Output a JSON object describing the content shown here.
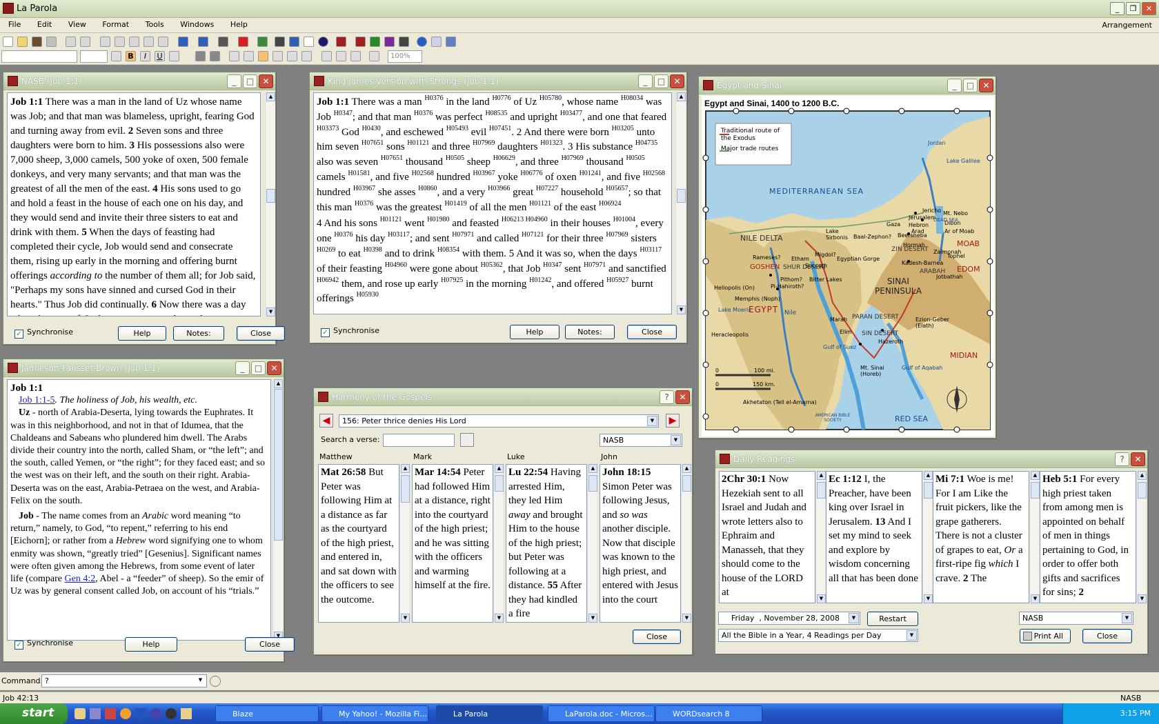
{
  "app": {
    "title": "La Parola"
  },
  "menu": [
    "File",
    "Edit",
    "View",
    "Format",
    "Tools",
    "Windows",
    "Help"
  ],
  "menu_right": "Arrangement",
  "format_bar": {
    "zoom": "100%"
  },
  "nasb": {
    "title": "NASB (Job 1:1)",
    "synchronise": "Synchronise",
    "help": "Help",
    "notes": "Notes:",
    "close": "Close",
    "ref": "Job 1:1",
    "text_a": " There was a man in the land of Uz whose name was Job; and that man was blameless, upright, fearing God and turning away from evil. ",
    "v2": "2",
    "text_b": " Seven sons and three daughters were born to him. ",
    "v3": "3",
    "text_c": " His possessions also were 7,000 sheep, 3,000 camels, 500 yoke of oxen, 500 female donkeys, and very many servants; and that man was the greatest of all the men of the east. ",
    "v4": "4",
    "text_d": " His sons used to go and hold a feast in the house of each one on his day, and they would send and invite their three sisters to eat and drink with them. ",
    "v5": "5",
    "text_e": " When the days of feasting had completed their cycle, Job would send and consecrate them, rising up early in the morning and offering burnt offerings ",
    "text_e_it": "according to",
    "text_f": " the number of them all; for Job said, \"Perhaps my sons have sinned and cursed God in their hearts.\" Thus Job did continually. ",
    "v6": "6",
    "text_g": " Now there was a day when the sons of God came to present themselves"
  },
  "kjv": {
    "title": "King James Version with Strongs (Job 1:1)",
    "synchronise": "Synchronise",
    "help": "Help",
    "notes": "Notes:",
    "close": "Close",
    "ref": "Job 1:1",
    "seg": [
      [
        "There was a man ",
        "H0376"
      ],
      [
        " in the land ",
        "H0776"
      ],
      [
        " of Uz ",
        "H05780"
      ],
      [
        ", whose name ",
        "H08034"
      ],
      [
        " was Job ",
        "H0347"
      ],
      [
        "; and that man ",
        "H0376"
      ],
      [
        " was perfect ",
        "H08535"
      ],
      [
        " and upright ",
        "H03477"
      ],
      [
        ", and one that feared ",
        "H03373"
      ],
      [
        " God ",
        "H0430"
      ],
      [
        ", and eschewed ",
        "H05493"
      ],
      [
        " evil ",
        "H07451"
      ],
      [
        ". 2 And there were born ",
        "H03205"
      ],
      [
        " unto him seven ",
        "H07651"
      ],
      [
        " sons ",
        "H01121"
      ],
      [
        " and three ",
        "H07969"
      ],
      [
        " daughters ",
        "H01323"
      ],
      [
        ". 3 His substance ",
        "H04735"
      ],
      [
        " also was seven ",
        "H07651"
      ],
      [
        " thousand ",
        "H0505"
      ],
      [
        " sheep ",
        "H06629"
      ],
      [
        ", and three ",
        "H07969"
      ],
      [
        " thousand ",
        "H0505"
      ],
      [
        " camels ",
        "H01581"
      ],
      [
        ", and five ",
        "H02568"
      ],
      [
        " hundred ",
        "H03967"
      ],
      [
        " yoke ",
        "H06776"
      ],
      [
        " of oxen ",
        "H01241"
      ],
      [
        ", and five ",
        "H02568"
      ],
      [
        " hundred ",
        "H03967"
      ],
      [
        " she asses ",
        "H0860"
      ],
      [
        ", and a very ",
        "H03966"
      ],
      [
        " great ",
        "H07227"
      ],
      [
        " household ",
        "H05657"
      ],
      [
        "; so that this man ",
        "H0376"
      ],
      [
        " was the greatest ",
        "H01419"
      ],
      [
        " of all the men ",
        "H01121"
      ],
      [
        " of the east ",
        "H06924"
      ]
    ],
    "seg2": [
      [
        "4 And his sons ",
        "H01121"
      ],
      [
        " went ",
        "H01980"
      ],
      [
        " and feasted ",
        "H06213 H04960"
      ],
      [
        " in their houses ",
        "H01004"
      ],
      [
        ", every one ",
        "H0376"
      ],
      [
        " his day ",
        "H03117"
      ],
      [
        "; and sent ",
        "H07971"
      ],
      [
        " and called ",
        "H07121"
      ],
      [
        " for their three ",
        "H07969"
      ],
      [
        " sisters ",
        "H0269"
      ],
      [
        " to eat ",
        "H0398"
      ],
      [
        " and to drink ",
        "H08354"
      ],
      [
        " with them. 5 And it was so, when the days ",
        "H03117"
      ],
      [
        " of their feasting ",
        "H04960"
      ],
      [
        " were gone about ",
        "H05362"
      ],
      [
        ", that Job ",
        "H0347"
      ],
      [
        " sent ",
        "H07971"
      ],
      [
        " and sanctified ",
        "H06942"
      ],
      [
        " them, and rose up early ",
        "H07925"
      ],
      [
        " in the morning ",
        "H01242"
      ],
      [
        ", and offered ",
        "H05927"
      ],
      [
        " burnt offerings ",
        "H05930"
      ]
    ]
  },
  "map": {
    "title": "Egypt and Sinai",
    "heading": "Egypt and Sinai, 1400 to 1200 B.C.",
    "legend": [
      "Traditional route of the Exodus",
      "Major trade routes"
    ],
    "labels": [
      "MEDITERRANEAN SEA",
      "NILE DELTA",
      "GOSHEN",
      "EGYPT",
      "SINAI PENINSULA",
      "MIDIAN",
      "RED SEA",
      "EDOM",
      "MOAB",
      "ZIN DESERT",
      "PARAN DESERT",
      "SIN DESERT",
      "SHUR DESERT",
      "Lake Galilee",
      "Jordan",
      "DEAD SEA",
      "Heliopolis (On)",
      "Memphis (Noph)",
      "Lake Moeris",
      "Heracleopolis",
      "Akhetaton (Tell el-Amarna)",
      "Mt. Sinai (Horeb)",
      "Ezion-Geber (Elath)",
      "Kadesh-Barnea",
      "Marah",
      "Elim",
      "Hazeroth",
      "Lake Sirbonis",
      "Baal-Zephon?",
      "Migdol?",
      "Succoth",
      "Pithom?",
      "Rameses?",
      "Egyptian Gorge",
      "Gaza",
      "Jerusalem",
      "Hebron",
      "Beersheba",
      "Arad",
      "Jericho",
      "Mt. Nebo",
      "Dibon",
      "Ar of Moab",
      "Tophel",
      "Zalmonah",
      "Jotbathah",
      "Hormah",
      "Bitter Lakes",
      "Pi-Hahiroth?",
      "Etham",
      "Nile",
      "ARABAH",
      "Gulf of Suez",
      "Gulf of Aqabah"
    ],
    "scale_mi": "100 mi.",
    "scale_km": "150 km.",
    "scale_zero": "0",
    "publisher": "AMERICAN BIBLE SOCIETY"
  },
  "jfb": {
    "title": "Jamieson-Fausset-Brown (Job 1:1)",
    "synchronise": "Synchronise",
    "help": "Help",
    "close": "Close",
    "ref": "Job 1:1",
    "link1": "Job 1:1-5",
    "summary": ". The holiness of Job, his wealth, etc.",
    "uz_head": "Uz",
    "uz_text": " - north of Arabia-Deserta, lying towards the Euphrates. It was in this neighborhood, and not in that of Idumea, that the Chaldeans and Sabeans who plundered him dwell. The Arabs divide their country into the north, called Sham, or “the left”; and the south, called Yemen, or “the right”; for they faced east; and so the west was on their left, and the south on their right. Arabia-Deserta was on the east, Arabia-Petraea on the west, and Arabia-Felix on the south.",
    "job_head": "Job",
    "job_text_a": " - The name comes from an ",
    "job_it1": "Arabic",
    "job_text_b": " word meaning “to return,” namely, to God, “to repent,” referring to his end [Eichorn]; or rather from a ",
    "job_it2": "Hebrew",
    "job_text_c": " word signifying one to whom enmity was shown, “greatly tried” [Gesenius]. Significant names were often given among the Hebrews, from some event of later life (compare ",
    "link2": "Gen 4:2",
    "job_text_d": ", Abel - a “feeder” of sheep). So the emir of Uz was by general consent called Job, on account of his “trials.”"
  },
  "harmony": {
    "title": "Harmony of the Gospels",
    "section": "156: Peter thrice denies His Lord",
    "search_label": "Search a verse:",
    "version": "NASB",
    "close": "Close",
    "cols": [
      {
        "name": "Matthew",
        "ref": "Mat 26:58",
        "text": " But Peter was following Him at a distance as far as the courtyard of the high priest, and entered in, and sat down with the officers to see the outcome."
      },
      {
        "name": "Mark",
        "ref": "Mar 14:54",
        "text": " Peter had followed Him at a distance, right into the courtyard of the high priest; and he was sitting with the officers and warming himself at the fire."
      },
      {
        "name": "Luke",
        "ref": "Lu 22:54",
        "text_a": " Having arrested Him, they led Him ",
        "it": "away",
        "text_b": " and brought Him to the house of the high priest; but Peter was following at a distance. ",
        "v": "55",
        "text_c": " After they had kindled a fire"
      },
      {
        "name": "John",
        "ref": "John 18:15",
        "text_a": " Simon Peter was following Jesus, and ",
        "it1": "so",
        "text_b": " ",
        "it2": "was",
        "text_c": " another disciple. Now that disciple was known to the high priest, and entered with Jesus into the court"
      }
    ]
  },
  "daily": {
    "title": "Daily Readings",
    "cols": [
      {
        "ref": "2Chr 30:1",
        "text": " Now Hezekiah sent to all Israel and Judah and wrote letters also to Ephraim and Manasseh, that they should come to the house of the LORD at"
      },
      {
        "ref": "Ec 1:12",
        "text_a": " I, the Preacher, have been king over Israel in Jerusalem. ",
        "v": "13",
        "text_b": " And I set my mind to seek and explore by wisdom concerning all that has been done"
      },
      {
        "ref": "Mi 7:1",
        "text_a": " Woe is me! For I am Like the fruit pickers, like the grape gatherers. There is not a cluster of grapes to eat, ",
        "it1": "Or",
        "text_b": " a first-ripe fig ",
        "it2": "which",
        "text_c": " I crave. ",
        "v": "2",
        "text_d": " The"
      },
      {
        "ref": "Heb 5:1",
        "text_a": " For every high priest taken from among men is appointed on behalf of men in things pertaining to God, in order to offer both gifts and sacrifices for sins; ",
        "v": "2"
      }
    ],
    "day": "Friday",
    "date": ", November 28, 2008",
    "restart": "Restart",
    "plan": "All the Bible in a Year, 4 Readings per Day",
    "version": "NASB",
    "print_all": "Print All",
    "close": "Close"
  },
  "command": {
    "label": "Command:",
    "value": "?"
  },
  "status": {
    "ref": "Job 42:13",
    "version": "NASB"
  },
  "taskbar": {
    "start": "start",
    "tasks": [
      "Blaze",
      "My Yahoo! - Mozilla Fi...",
      "La Parola",
      "LaParola.doc - Micros...",
      "WORDsearch 8"
    ],
    "time": "3:15 PM"
  }
}
